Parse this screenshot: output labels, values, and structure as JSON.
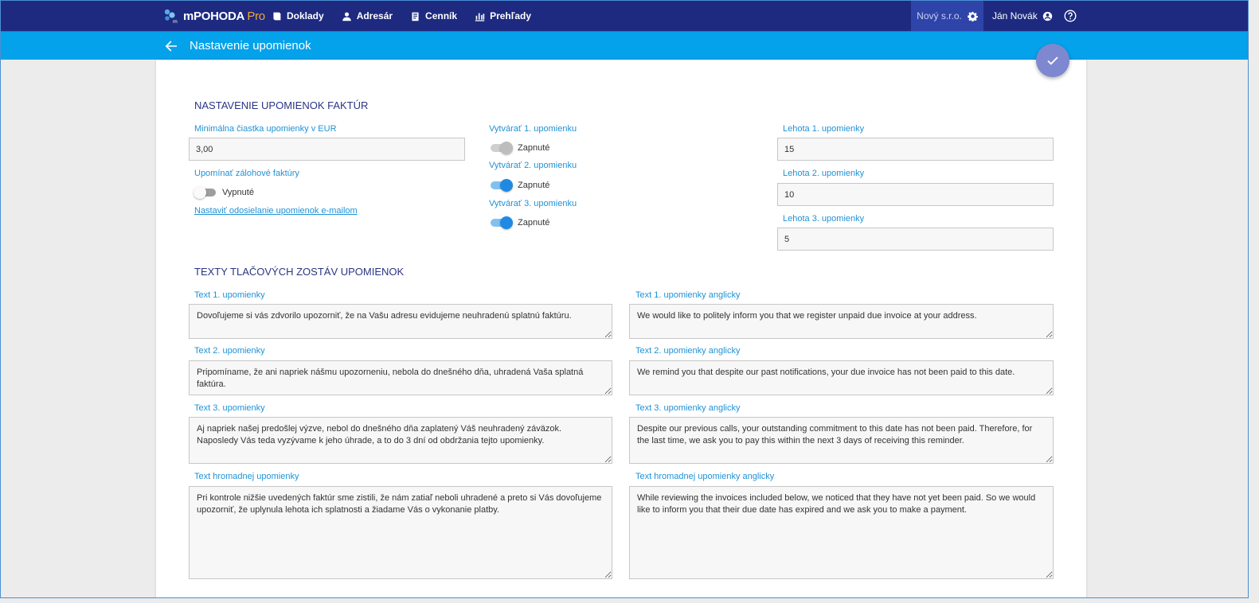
{
  "app": {
    "brand": "mPOHODA",
    "brand_suffix": "Pro"
  },
  "nav": {
    "items": [
      {
        "label": "Doklady",
        "icon": "documents-icon"
      },
      {
        "label": "Adresár",
        "icon": "person-icon"
      },
      {
        "label": "Cenník",
        "icon": "pricelist-icon"
      },
      {
        "label": "Prehľady",
        "icon": "chart-icon"
      }
    ],
    "company": "Nový s.r.o.",
    "user": "Ján Novák"
  },
  "page": {
    "title": "Nastavenie upomienok"
  },
  "reminders": {
    "section_title": "NASTAVENIE UPOMIENOK FAKTÚR",
    "min_amount_label": "Minimálna čiastka upomienky v EUR",
    "min_amount_value": "3,00",
    "advance_label": "Upomínať zálohové faktúry",
    "advance_state": "Vypnuté",
    "email_link": "Nastaviť odosielanie upomienok e-mailom",
    "create1_label": "Vytvárať 1. upomienku",
    "create1_state": "Zapnuté",
    "create2_label": "Vytvárať 2. upomienku",
    "create2_state": "Zapnuté",
    "create3_label": "Vytvárať 3. upomienku",
    "create3_state": "Zapnuté",
    "period1_label": "Lehota 1. upomienky",
    "period1_value": "15",
    "period2_label": "Lehota 2. upomienky",
    "period2_value": "10",
    "period3_label": "Lehota 3. upomienky",
    "period3_value": "5"
  },
  "texts": {
    "section_title": "TEXTY TLAČOVÝCH ZOSTÁV UPOMIENOK",
    "t1_label": "Text 1. upomienky",
    "t1_value": "Dovoľujeme si vás zdvorilo upozorniť, že na Vašu adresu evidujeme neuhradenú splatnú faktúru.",
    "t1en_label": "Text 1. upomienky anglicky",
    "t1en_value": "We would like to politely inform you that we register unpaid due invoice at your address.",
    "t2_label": "Text 2. upomienky",
    "t2_value": "Pripomíname, že ani napriek nášmu upozorneniu, nebola do dnešného dňa, uhradená Vaša splatná faktúra.",
    "t2en_label": "Text 2. upomienky anglicky",
    "t2en_value": "We remind you that despite our past notifications, your due invoice has not been paid to this date.",
    "t3_label": "Text 3. upomienky",
    "t3_value": "Aj napriek našej predošlej výzve, nebol do dnešného dňa zaplatený Váš neuhradený záväzok. Naposledy Vás teda vyzývame k jeho úhrade, a to do 3 dní od obdržania tejto upomienky.",
    "t3en_label": "Text 3. upomienky anglicky",
    "t3en_value": "Despite our previous calls, your outstanding commitment to this date has not been paid. Therefore, for the last time, we ask you to pay this within the next 3 days of receiving this reminder.",
    "bulk_label": "Text hromadnej upomienky",
    "bulk_value": "Pri kontrole nižšie uvedených faktúr sme zistili, že nám zatiaľ neboli uhradené a preto si Vás dovoľujeme upozorniť, že uplynula lehota ich splatnosti a žiadame Vás o vykonanie platby.",
    "bulken_label": "Text hromadnej upomienky anglicky",
    "bulken_value": "While reviewing the invoices included below, we noticed that they have not yet been paid. So we would like to inform you that their due date has expired and we ask you to make a payment."
  }
}
